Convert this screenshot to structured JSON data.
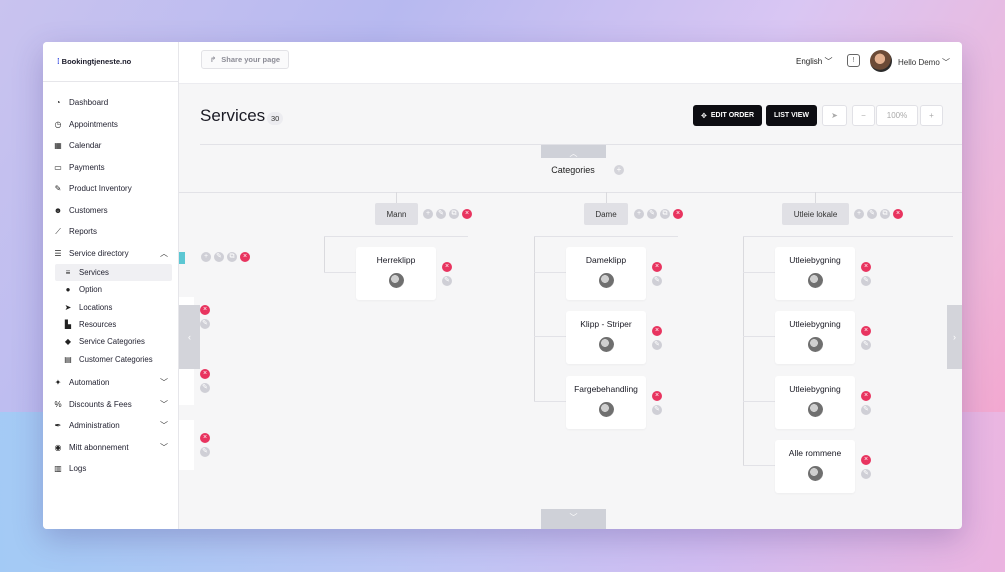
{
  "app": {
    "logo_text": "Bookingtjeneste.no"
  },
  "sidebar": {
    "items": [
      {
        "label": "Dashboard",
        "icon": "gauge-icon",
        "glyph": "◔"
      },
      {
        "label": "Appointments",
        "icon": "clock-icon",
        "glyph": "◷"
      },
      {
        "label": "Calendar",
        "icon": "calendar-icon",
        "glyph": "▦"
      },
      {
        "label": "Payments",
        "icon": "card-icon",
        "glyph": "▭"
      },
      {
        "label": "Product Inventory",
        "icon": "tools-icon",
        "glyph": "✎"
      },
      {
        "label": "Customers",
        "icon": "users-icon",
        "glyph": "☻"
      },
      {
        "label": "Reports",
        "icon": "chart-icon",
        "glyph": "⟋"
      },
      {
        "label": "Service directory",
        "icon": "list-icon",
        "glyph": "☰"
      }
    ],
    "sub_items": [
      {
        "label": "Services",
        "icon": "list-lines-icon",
        "glyph": "≡"
      },
      {
        "label": "Option",
        "icon": "person-icon",
        "glyph": "●"
      },
      {
        "label": "Locations",
        "icon": "location-arrow-icon",
        "glyph": "➤"
      },
      {
        "label": "Resources",
        "icon": "building-icon",
        "glyph": "▙"
      },
      {
        "label": "Service Categories",
        "icon": "tags-icon",
        "glyph": "◆"
      },
      {
        "label": "Customer Categories",
        "icon": "id-card-icon",
        "glyph": "▤"
      }
    ],
    "bottom_items": [
      {
        "label": "Automation",
        "icon": "wand-icon",
        "glyph": "✦"
      },
      {
        "label": "Discounts & Fees",
        "icon": "percent-icon",
        "glyph": "%"
      },
      {
        "label": "Administration",
        "icon": "wrench-icon",
        "glyph": "✒"
      },
      {
        "label": "Mitt abonnement",
        "icon": "user-circle-icon",
        "glyph": "◉"
      },
      {
        "label": "Logs",
        "icon": "clipboard-icon",
        "glyph": "▥"
      }
    ]
  },
  "topbar": {
    "share_label": "Share your page",
    "language": "English",
    "greeting": "Hello Demo"
  },
  "main": {
    "title": "Services",
    "count": "30",
    "edit_order_label": "EDIT ORDER",
    "list_view_label": "LIST VIEW",
    "zoom": "100%",
    "zoom_out": "−",
    "zoom_in": "+",
    "root_label": "Categories",
    "categories": [
      {
        "name": "Mann",
        "services": [
          "Herreklipp"
        ]
      },
      {
        "name": "Dame",
        "services": [
          "Dameklipp",
          "Klipp - Striper",
          "Fargebehandling"
        ]
      },
      {
        "name": "Utleie lokale",
        "services": [
          "Utleiebygning",
          "Utleiebygning",
          "Utleiebygning",
          "Alle rommene"
        ]
      }
    ]
  },
  "colors": {
    "accent_dark": "#0d0d12",
    "delete": "#e8345f",
    "neutral": "#cfcfd6"
  }
}
